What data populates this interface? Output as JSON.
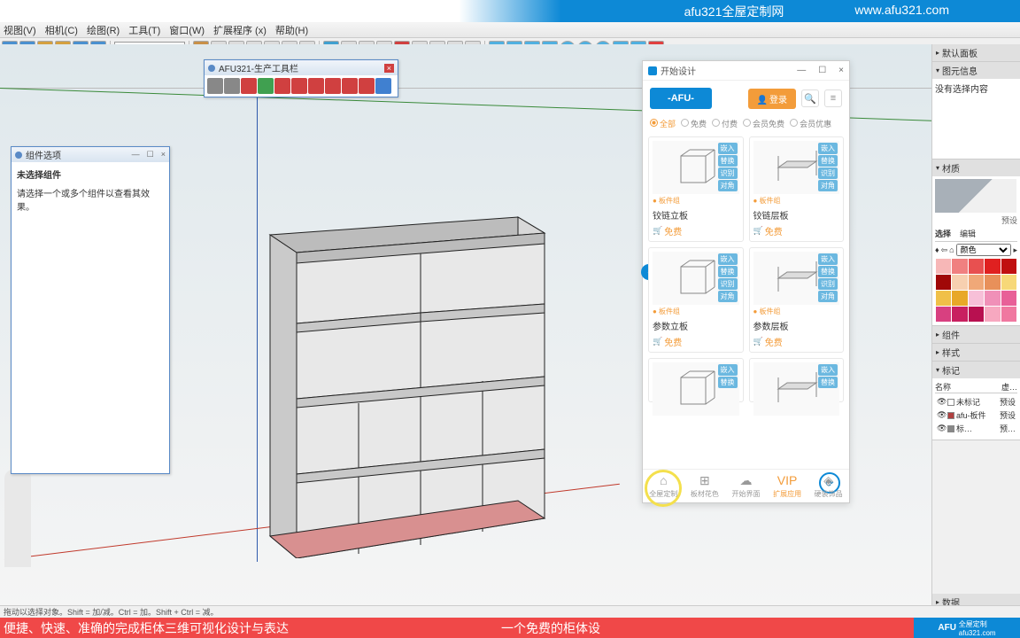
{
  "banner": {
    "text1": "afu321全屋定制网",
    "text2": "www.afu321.com"
  },
  "menu": [
    "视图(V)",
    "相机(C)",
    "绘图(R)",
    "工具(T)",
    "窗口(W)",
    "扩展程序 (x)",
    "帮助(H)"
  ],
  "tag_input": "未标记",
  "prod_toolbar_title": "AFU321-生产工具栏",
  "component_panel": {
    "title": "组件选项",
    "heading": "未选择组件",
    "hint": "请选择一个或多个组件以查看其效果。"
  },
  "right": {
    "default_tray": "默认面板",
    "entity_info": "图元信息",
    "entity_empty": "没有选择内容",
    "materials": "材质",
    "preset": "预设",
    "select": "选择",
    "edit": "编辑",
    "colors_label": "颜色",
    "components": "组件",
    "styles": "样式",
    "tags": "标记",
    "tag_col_name": "名称",
    "tag_col_dash": "虚…",
    "tags_list": [
      {
        "name": "未标记",
        "dash": "预设"
      },
      {
        "name": "afu-板件",
        "dash": "预设"
      },
      {
        "name": "标…",
        "dash": "预…"
      }
    ],
    "data": "数据"
  },
  "dialog": {
    "title": "开始设计",
    "login": "登录",
    "filters": [
      "全部",
      "免费",
      "付费",
      "会员免费",
      "会员优惠"
    ],
    "cards": [
      {
        "tag": "● 板件组",
        "name": "铰链立板",
        "price": "免费",
        "btns": [
          "嵌入",
          "替换",
          "识别",
          "对角"
        ]
      },
      {
        "tag": "● 板件组",
        "name": "铰链层板",
        "price": "免费",
        "btns": [
          "嵌入",
          "替换",
          "识别",
          "对角"
        ]
      },
      {
        "tag": "● 板件组",
        "name": "参数立板",
        "price": "免费",
        "btns": [
          "嵌入",
          "替换",
          "识别",
          "对角"
        ]
      },
      {
        "tag": "● 板件组",
        "name": "参数层板",
        "price": "免费",
        "btns": [
          "嵌入",
          "替换",
          "识别",
          "对角"
        ]
      },
      {
        "tag": "",
        "name": "",
        "price": "",
        "btns": [
          "嵌入",
          "替换"
        ]
      },
      {
        "tag": "",
        "name": "",
        "price": "",
        "btns": [
          "嵌入",
          "替换"
        ]
      }
    ],
    "bottom": [
      "全屋定制",
      "板材花色",
      "开始界面",
      "扩展应用",
      "硬装饰品"
    ],
    "vip": "VIP"
  },
  "statusbar": "拖动以选择对象。Shift = 加/减。Ctrl = 加。Shift + Ctrl = 减。",
  "bottom_banner": {
    "t1": "便捷、快速、准确的完成柜体三维可视化设计与表达",
    "t2": "一个免费的柜体设",
    "badge": "AFU 全屋定制"
  },
  "colors": [
    "#f7b7b7",
    "#f08080",
    "#e85050",
    "#e02020",
    "#c01010",
    "#a00808",
    "#f7d0b0",
    "#f0a878",
    "#e8905a",
    "#f7d878",
    "#f0c048",
    "#e8a828",
    "#f7c0d8",
    "#f090b8",
    "#e86098",
    "#d84080",
    "#c82060",
    "#b81050",
    "#f7a8c0",
    "#f078a0"
  ]
}
